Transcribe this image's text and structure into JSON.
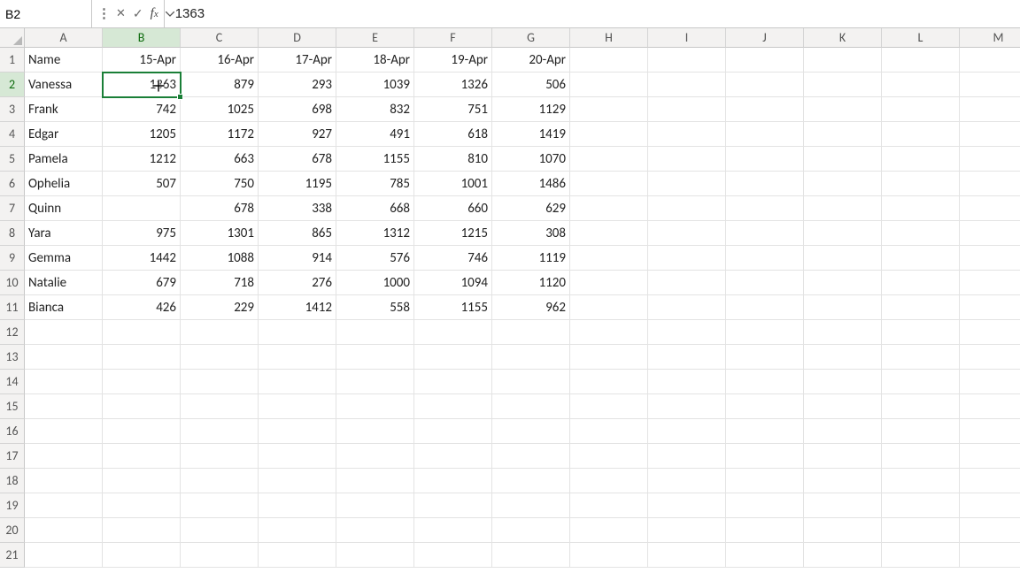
{
  "formula_bar": {
    "name_box": "B2",
    "formula": "1363"
  },
  "active_cell": {
    "col": "B",
    "row": 2
  },
  "columns": [
    "A",
    "B",
    "C",
    "D",
    "E",
    "F",
    "G",
    "H",
    "I",
    "J",
    "K",
    "L",
    "M"
  ],
  "row_count_visible": 21,
  "data_cols": 7,
  "table": {
    "headers": [
      "Name",
      "15-Apr",
      "16-Apr",
      "17-Apr",
      "18-Apr",
      "19-Apr",
      "20-Apr"
    ],
    "rows": [
      [
        "Vanessa",
        1363,
        879,
        293,
        1039,
        1326,
        506
      ],
      [
        "Frank",
        742,
        1025,
        698,
        832,
        751,
        1129
      ],
      [
        "Edgar",
        1205,
        1172,
        927,
        491,
        618,
        1419
      ],
      [
        "Pamela",
        1212,
        663,
        678,
        1155,
        810,
        1070
      ],
      [
        "Ophelia",
        507,
        750,
        1195,
        785,
        1001,
        1486
      ],
      [
        "Quinn",
        null,
        678,
        338,
        668,
        660,
        629
      ],
      [
        "Yara",
        975,
        1301,
        865,
        1312,
        1215,
        308
      ],
      [
        "Gemma",
        1442,
        1088,
        914,
        576,
        746,
        1119
      ],
      [
        "Natalie",
        679,
        718,
        276,
        1000,
        1094,
        1120
      ],
      [
        "Bianca",
        426,
        229,
        1412,
        558,
        1155,
        962
      ]
    ]
  },
  "chart_data": {
    "type": "table",
    "title": "",
    "columns": [
      "Name",
      "15-Apr",
      "16-Apr",
      "17-Apr",
      "18-Apr",
      "19-Apr",
      "20-Apr"
    ],
    "rows": [
      {
        "Name": "Vanessa",
        "15-Apr": 1363,
        "16-Apr": 879,
        "17-Apr": 293,
        "18-Apr": 1039,
        "19-Apr": 1326,
        "20-Apr": 506
      },
      {
        "Name": "Frank",
        "15-Apr": 742,
        "16-Apr": 1025,
        "17-Apr": 698,
        "18-Apr": 832,
        "19-Apr": 751,
        "20-Apr": 1129
      },
      {
        "Name": "Edgar",
        "15-Apr": 1205,
        "16-Apr": 1172,
        "17-Apr": 927,
        "18-Apr": 491,
        "19-Apr": 618,
        "20-Apr": 1419
      },
      {
        "Name": "Pamela",
        "15-Apr": 1212,
        "16-Apr": 663,
        "17-Apr": 678,
        "18-Apr": 1155,
        "19-Apr": 810,
        "20-Apr": 1070
      },
      {
        "Name": "Ophelia",
        "15-Apr": 507,
        "16-Apr": 750,
        "17-Apr": 1195,
        "18-Apr": 785,
        "19-Apr": 1001,
        "20-Apr": 1486
      },
      {
        "Name": "Quinn",
        "15-Apr": null,
        "16-Apr": 678,
        "17-Apr": 338,
        "18-Apr": 668,
        "19-Apr": 660,
        "20-Apr": 629
      },
      {
        "Name": "Yara",
        "15-Apr": 975,
        "16-Apr": 1301,
        "17-Apr": 865,
        "18-Apr": 1312,
        "19-Apr": 1215,
        "20-Apr": 308
      },
      {
        "Name": "Gemma",
        "15-Apr": 1442,
        "16-Apr": 1088,
        "17-Apr": 914,
        "18-Apr": 576,
        "19-Apr": 746,
        "20-Apr": 1119
      },
      {
        "Name": "Natalie",
        "15-Apr": 679,
        "16-Apr": 718,
        "17-Apr": 276,
        "18-Apr": 1000,
        "19-Apr": 1094,
        "20-Apr": 1120
      },
      {
        "Name": "Bianca",
        "15-Apr": 426,
        "16-Apr": 229,
        "17-Apr": 1412,
        "18-Apr": 558,
        "19-Apr": 1155,
        "20-Apr": 962
      }
    ]
  }
}
